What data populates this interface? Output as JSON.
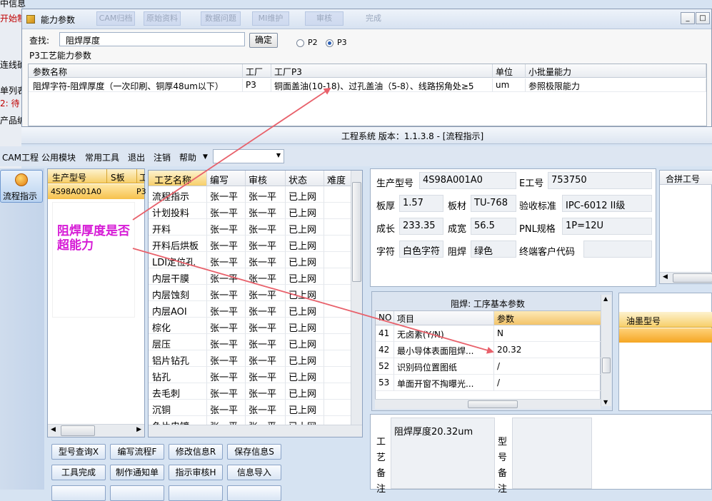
{
  "background_app": {
    "fragments": [
      "中信息",
      "开始制",
      "连线确",
      "单列表",
      "2: 待",
      "产品编"
    ]
  },
  "dialog": {
    "title": "能力参数",
    "ghost_tabs": [
      "CAM归档",
      "原始资料",
      "数据问题",
      "MI维护",
      "审核",
      "完成"
    ],
    "search_label": "查找:",
    "search_value": "阻焊厚度",
    "confirm_button": "确定",
    "radio_p2": "P2",
    "radio_p3": "P3",
    "selected_radio": "P3",
    "section_label": "P3工艺能力参数",
    "columns": [
      "参数名称",
      "工厂",
      "工厂P3",
      "单位",
      "小批量能力"
    ],
    "rows": [
      [
        "阻焊字符-阻焊厚度（一次印刷、铜厚48um以下）",
        "P3",
        "铜面盖油(10-18)、过孔盖油（5-8）、线路拐角处≥5",
        "um",
        "参照极限能力"
      ]
    ]
  },
  "main_window": {
    "title": "工程系统  版本：1.1.3.8 - [流程指示]",
    "menu": [
      "CAM工程",
      "公用模块",
      "常用工具",
      "退出",
      "注销",
      "帮助"
    ],
    "left_button": "流程指示",
    "model_list": {
      "columns": [
        "生产型号",
        "S板",
        "工"
      ],
      "rows": [
        [
          "4S98A001A0",
          "",
          "P3"
        ]
      ]
    },
    "annotation": "阻焊厚度是否超能力",
    "process_table": {
      "columns": [
        "工艺名称",
        "编写",
        "审核",
        "状态",
        "难度"
      ],
      "rows": [
        [
          "流程指示",
          "张一平",
          "张一平",
          "已上网"
        ],
        [
          "计划投料",
          "张一平",
          "张一平",
          "已上网"
        ],
        [
          "开料",
          "张一平",
          "张一平",
          "已上网"
        ],
        [
          "开料后烘板",
          "张一平",
          "张一平",
          "已上网"
        ],
        [
          "LDI定位孔",
          "张一平",
          "张一平",
          "已上网"
        ],
        [
          "内层干膜",
          "张一平",
          "张一平",
          "已上网"
        ],
        [
          "内层蚀刻",
          "张一平",
          "张一平",
          "已上网"
        ],
        [
          "内层AOI",
          "张一平",
          "张一平",
          "已上网"
        ],
        [
          "棕化",
          "张一平",
          "张一平",
          "已上网"
        ],
        [
          "层压",
          "张一平",
          "张一平",
          "已上网"
        ],
        [
          "铝片钻孔",
          "张一平",
          "张一平",
          "已上网"
        ],
        [
          "钻孔",
          "张一平",
          "张一平",
          "已上网"
        ],
        [
          "去毛刺",
          "张一平",
          "张一平",
          "已上网"
        ],
        [
          "沉铜",
          "张一平",
          "张一平",
          "已上网"
        ],
        [
          "负片电镀",
          "张一平",
          "张一平",
          "已上网"
        ]
      ]
    },
    "action_buttons": [
      [
        "型号查询X",
        "编写流程F",
        "修改信息R",
        "保存信息S"
      ],
      [
        "工具完成",
        "制作通知单",
        "指示审核H",
        "信息导入"
      ]
    ],
    "info": {
      "model_label": "生产型号",
      "model_value": "4S98A001A0",
      "e_label": "E工号",
      "e_value": "753750",
      "thick_label": "板厚",
      "thick_value": "1.57",
      "mat_label": "板材",
      "mat_value": "TU-768",
      "std_label": "验收标准",
      "std_value": "IPC-6012 II级",
      "len_label": "成长",
      "len_value": "233.35",
      "wid_label": "成宽",
      "wid_value": "56.5",
      "pnl_label": "PNL规格",
      "pnl_value": "1P=12U",
      "char_label": "字符",
      "char_value": "白色字符",
      "mask_label": "阻焊",
      "mask_value": "绿色",
      "cust_label": "终端客户代码",
      "cust_value": ""
    },
    "merge_label": "合拼工号",
    "basic_params": {
      "title": "阻焊: 工序基本参数",
      "columns": [
        "NO",
        "项目",
        "参数"
      ],
      "rows": [
        [
          "41",
          "无卤素(Y/N)",
          "N"
        ],
        [
          "42",
          "最小导体表面阻焊...",
          "20.32"
        ],
        [
          "52",
          "识别码位置图纸",
          "/"
        ],
        [
          "53",
          "单面开窗不掏曝光...",
          "/"
        ]
      ]
    },
    "ink_label": "油墨型号",
    "process_note_label": "工艺备注",
    "process_note_value": "阻焊厚度20.32um",
    "model_note_label": "型号备注",
    "arrow_color": "#e8616b"
  }
}
